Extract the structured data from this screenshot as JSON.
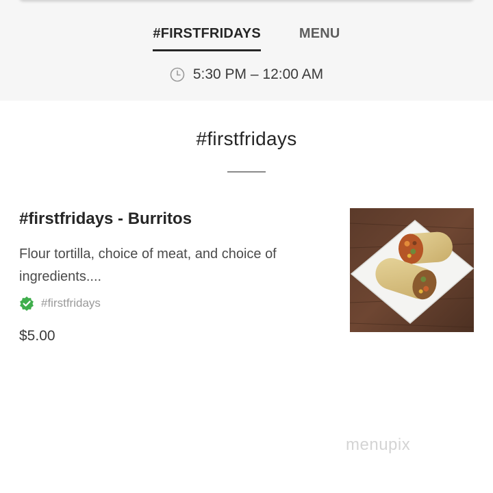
{
  "tabs": [
    {
      "label": "#FIRSTFRIDAYS",
      "active": true
    },
    {
      "label": "MENU",
      "active": false
    }
  ],
  "hours": {
    "icon": "clock-icon",
    "text": "5:30 PM – 12:00 AM"
  },
  "section": {
    "title": "#firstfridays"
  },
  "item": {
    "name": "#firstfridays - Burritos",
    "description": "Flour tortilla, choice of meat, and choice of ingredients....",
    "badge_icon": "verified-check-icon",
    "badge_label": "#firstfridays",
    "price": "$5.00",
    "image": "burrito-photo"
  },
  "watermark": "menupix",
  "colors": {
    "top_band": "#f6f6f6",
    "text": "#262626",
    "verified_green": "#3fae4c",
    "tab_underline": "#262626"
  }
}
